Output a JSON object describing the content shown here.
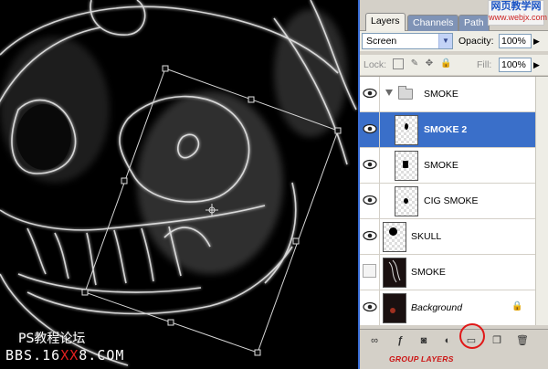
{
  "watermark": {
    "site_cn": "PS教程论坛",
    "bbs_prefix": "BBS.16",
    "bbs_xx": "XX",
    "bbs_suffix": "8.COM"
  },
  "panel": {
    "tabs": [
      "Layers",
      "Channels",
      "Path"
    ],
    "site_badge": {
      "title": "网页教学网",
      "url": "www.webjx.com"
    },
    "blend_mode": "Screen",
    "opacity_label": "Opacity:",
    "opacity_value": "100%",
    "lock_label": "Lock:",
    "fill_label": "Fill:",
    "fill_value": "100%",
    "layers": [
      {
        "name": "SMOKE",
        "type": "group",
        "visible": true,
        "selected": false
      },
      {
        "name": "SMOKE 2",
        "type": "layer",
        "visible": true,
        "selected": true
      },
      {
        "name": "SMOKE",
        "type": "layer",
        "visible": true,
        "selected": false
      },
      {
        "name": "CIG SMOKE",
        "type": "layer",
        "visible": true,
        "selected": false
      },
      {
        "name": "SKULL",
        "type": "layer",
        "visible": true,
        "selected": false
      },
      {
        "name": "SMOKE",
        "type": "layer",
        "visible": false,
        "selected": false
      },
      {
        "name": "Background",
        "type": "background",
        "visible": true,
        "selected": false,
        "locked": true
      }
    ],
    "bottom_icons": [
      "link-icon",
      "fx-icon",
      "mask-icon",
      "adjustment-icon",
      "new-group-icon",
      "new-layer-icon",
      "trash-icon"
    ],
    "annotation": "GROUP LAYERS",
    "colors": {
      "selected": "#3a6fc9",
      "annotation": "#cc1414"
    }
  }
}
